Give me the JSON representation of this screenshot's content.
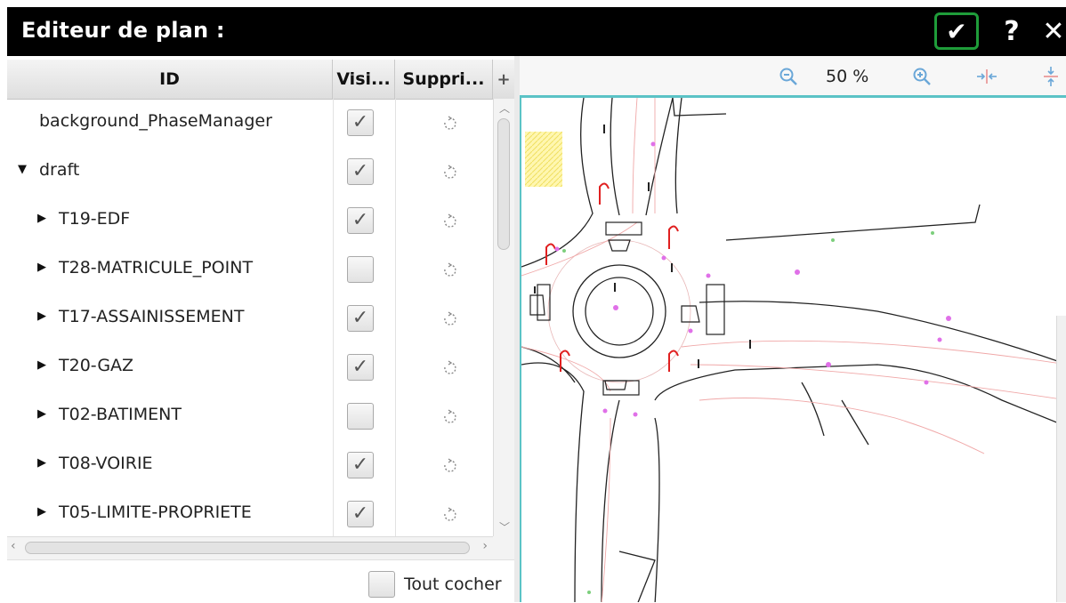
{
  "window": {
    "title": "Editeur de plan :"
  },
  "titlebar_buttons": {
    "confirm": "✔",
    "help": "?",
    "close": "✕"
  },
  "columns": {
    "id": "ID",
    "visible": "Visi...",
    "delete": "Suppri...",
    "add": "+"
  },
  "rows": [
    {
      "label": "background_PhaseManager",
      "indent": 0,
      "expander": "",
      "checked": true
    },
    {
      "label": "draft",
      "indent": 0,
      "expander": "▼",
      "checked": true
    },
    {
      "label": "T19-EDF",
      "indent": 1,
      "expander": "▶",
      "checked": true
    },
    {
      "label": "T28-MATRICULE_POINT",
      "indent": 1,
      "expander": "▶",
      "checked": false
    },
    {
      "label": "T17-ASSAINISSEMENT",
      "indent": 1,
      "expander": "▶",
      "checked": true
    },
    {
      "label": "T20-GAZ",
      "indent": 1,
      "expander": "▶",
      "checked": true
    },
    {
      "label": "T02-BATIMENT",
      "indent": 1,
      "expander": "▶",
      "checked": false
    },
    {
      "label": "T08-VOIRIE",
      "indent": 1,
      "expander": "▶",
      "checked": true
    },
    {
      "label": "T05-LIMITE-PROPRIETE",
      "indent": 1,
      "expander": "▶",
      "checked": true
    }
  ],
  "check_all": {
    "label": "Tout cocher",
    "checked": false
  },
  "zoom": {
    "level": "50 %"
  },
  "icons": {
    "zoom_out": "zoom-out-icon",
    "zoom_in": "zoom-in-icon",
    "fit_width": "fit-width-icon",
    "fit_height": "fit-height-icon",
    "delete": "trash-icon"
  },
  "colors": {
    "confirm_border": "#1f9d3a",
    "map_border": "#5bc3c6",
    "map_red": "#e02020",
    "map_magenta": "#e070e8"
  }
}
